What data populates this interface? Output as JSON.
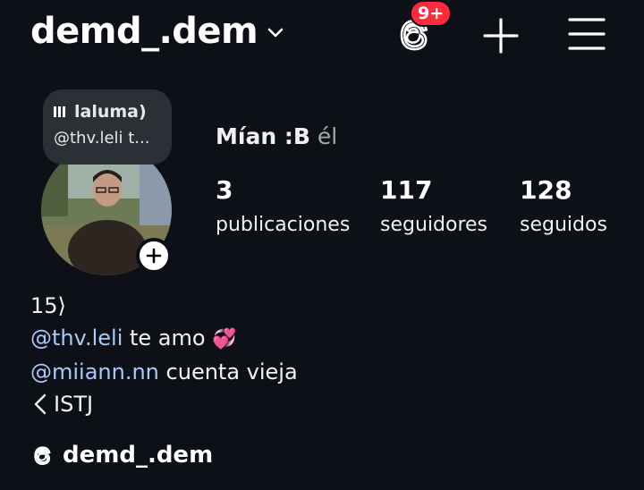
{
  "header": {
    "username": "demd_.dem",
    "notification_badge": "9+"
  },
  "note": {
    "song": "laluma)",
    "mention": "@thv.leli t..."
  },
  "profile": {
    "display_name": "Mían :B",
    "pronouns": "él"
  },
  "stats": {
    "posts": {
      "value": "3",
      "label": "publicaciones"
    },
    "followers": {
      "value": "117",
      "label": "seguidores"
    },
    "following": {
      "value": "128",
      "label": "seguidos"
    }
  },
  "bio": {
    "line1": "15⟩",
    "line2_mention": "@thv.leli",
    "line2_text": " te amo ",
    "line2_emoji": "💞",
    "line3_mention": "@miiann.nn",
    "line3_text": " cuenta vieja",
    "line4": "ISTJ"
  },
  "threads": {
    "handle": "demd_.dem"
  },
  "colors": {
    "background": "#0d1117",
    "mention": "#a9c9f7",
    "badge": "#ff2b3d"
  }
}
